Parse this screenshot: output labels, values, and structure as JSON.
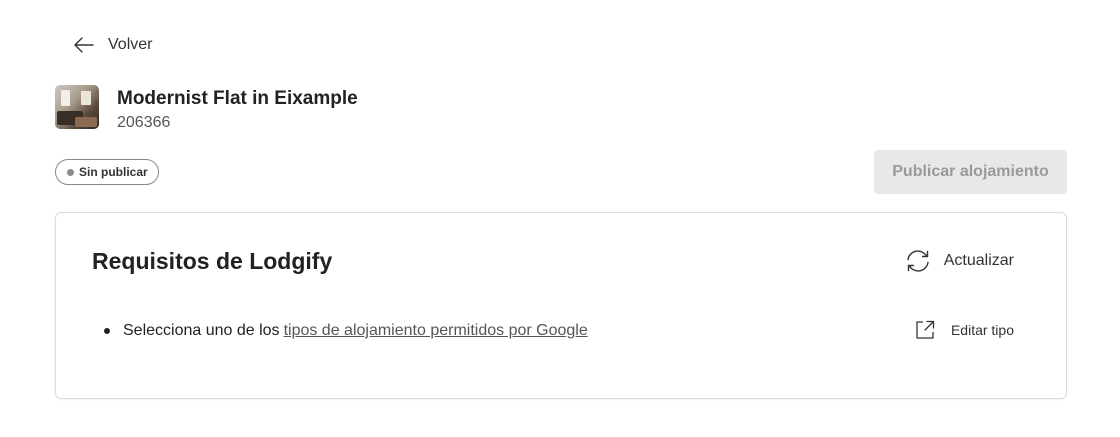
{
  "header": {
    "back_label": "Volver"
  },
  "property": {
    "name": "Modernist Flat in Eixample",
    "id": "206366",
    "thumbnail_icon": "property-photo"
  },
  "status": {
    "label": "Sin publicar",
    "dot_color": "#8a8a8a"
  },
  "actions": {
    "publish_label": "Publicar alojamiento",
    "publish_enabled": false
  },
  "requirements_card": {
    "title": "Requisitos de Lodgify",
    "refresh_label": "Actualizar",
    "items": [
      {
        "text": "Selecciona uno de los",
        "link_text": "tipos de alojamiento permitidos por Google",
        "action_label": "Editar tipo",
        "action_icon": "external-link-icon"
      }
    ]
  }
}
